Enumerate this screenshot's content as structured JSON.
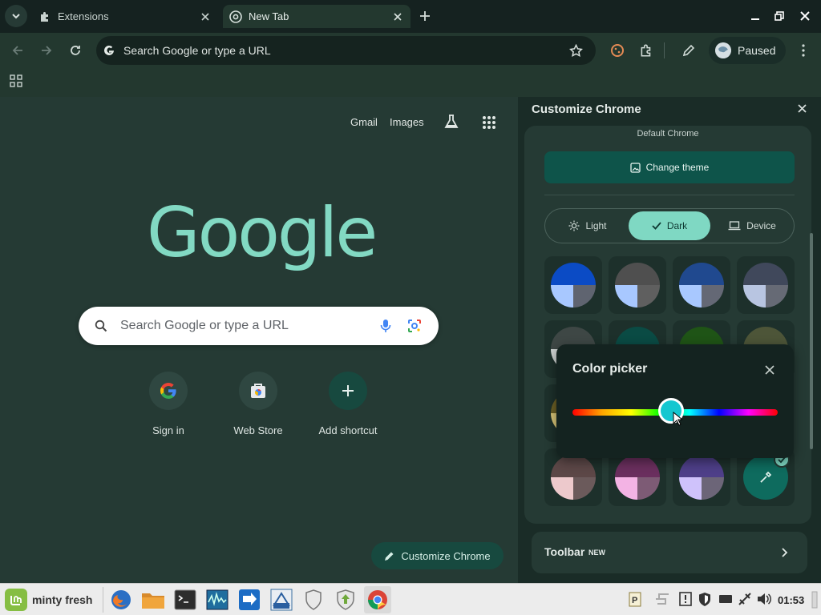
{
  "colors": {
    "accent": "#7fd8c3",
    "tab_bg": "#152220",
    "ntp_bg": "#253a34",
    "panel_bg": "#1a2c27"
  },
  "tabs": [
    {
      "title": "Extensions",
      "icon": "puzzle-icon"
    },
    {
      "title": "New Tab",
      "icon": "chrome-icon"
    }
  ],
  "omnibox": {
    "placeholder": "Search Google or type a URL"
  },
  "profile": {
    "label": "Paused"
  },
  "ntp": {
    "links": {
      "gmail": "Gmail",
      "images": "Images"
    },
    "logo": "Google",
    "search_placeholder": "Search Google or type a URL",
    "shortcuts": [
      {
        "label": "Sign in",
        "icon": "google-g-icon"
      },
      {
        "label": "Web Store",
        "icon": "web-store-icon"
      },
      {
        "label": "Add shortcut",
        "icon": "plus-icon"
      }
    ],
    "customize_label": "Customize Chrome"
  },
  "side_panel": {
    "title": "Customize Chrome",
    "theme_name": "Default Chrome",
    "change_theme_label": "Change theme",
    "modes": {
      "light": "Light",
      "dark": "Dark",
      "device": "Device",
      "selected": "Dark"
    },
    "swatches_row1": [
      {
        "top": "#0b4bc5",
        "left": "#a8c8ff",
        "right": "#5f6470"
      },
      {
        "top": "#4f4f4f",
        "left": "#a8c8ff",
        "right": "#5f5f5f"
      },
      {
        "top": "#20498f",
        "left": "#a8c8ff",
        "right": "#646875"
      },
      {
        "top": "#40485b",
        "left": "#b8c5e1",
        "right": "#666a75"
      }
    ],
    "swatches_row4": [
      {
        "top": "#5c4747",
        "left": "#edc9cc",
        "right": "#6b5a5b"
      },
      {
        "top": "#6a2f5e",
        "left": "#f3b3e4",
        "right": "#7d5b75"
      },
      {
        "top": "#4e3f88",
        "left": "#cfc2fb",
        "right": "#6c6578"
      }
    ],
    "custom_swatch_color": "#0e6b5e",
    "color_picker_title": "Color picker",
    "hue_value": 0.48,
    "toolbar_label": "Toolbar",
    "toolbar_badge": "NEW"
  },
  "taskbar": {
    "menu_label": "minty fresh",
    "clock": "01:53"
  }
}
